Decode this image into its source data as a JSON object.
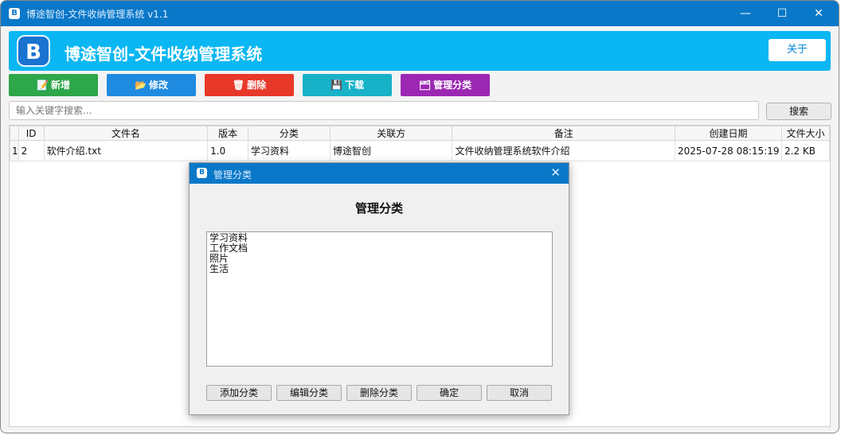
{
  "window": {
    "title": "博途智创-文件收纳管理系统 v1.1",
    "app_icon": "B",
    "minimize": "—",
    "maximize": "☐",
    "close": "✕"
  },
  "header": {
    "logo_text": "B",
    "title": "博途智创-文件收纳管理系统",
    "about_label": "关于"
  },
  "toolbar": {
    "add": {
      "label": "新增",
      "icon": "add-file-icon",
      "glyph": "📝",
      "color": "#2ea64a"
    },
    "edit": {
      "label": "修改",
      "icon": "folder-icon",
      "glyph": "📂",
      "color": "#1f8be0"
    },
    "delete": {
      "label": "删除",
      "icon": "trash-icon",
      "glyph": "🗑",
      "color": "#e8382a"
    },
    "download": {
      "label": "下载",
      "icon": "save-icon",
      "glyph": "💾",
      "color": "#17b2c8"
    },
    "manage": {
      "label": "管理分类",
      "icon": "category-icon",
      "glyph": "🗂",
      "color": "#9b27b3"
    }
  },
  "search": {
    "placeholder": "输入关键字搜索...",
    "button_label": "搜索"
  },
  "table": {
    "columns": [
      "",
      "ID",
      "文件名",
      "版本",
      "分类",
      "关联方",
      "备注",
      "创建日期",
      "文件大小"
    ],
    "rows": [
      [
        "1",
        "2",
        "软件介绍.txt",
        "1.0",
        "学习资料",
        "博途智创",
        "文件收纳管理系统软件介绍",
        "2025-07-28 08:15:19",
        "2.2 KB"
      ]
    ]
  },
  "dialog": {
    "title": "管理分类",
    "heading": "管理分类",
    "close": "✕",
    "categories": [
      "学习资料",
      "工作文档",
      "照片",
      "生活"
    ],
    "buttons": {
      "add": "添加分类",
      "edit": "编辑分类",
      "delete": "删除分类",
      "ok": "确定",
      "cancel": "取消"
    }
  }
}
